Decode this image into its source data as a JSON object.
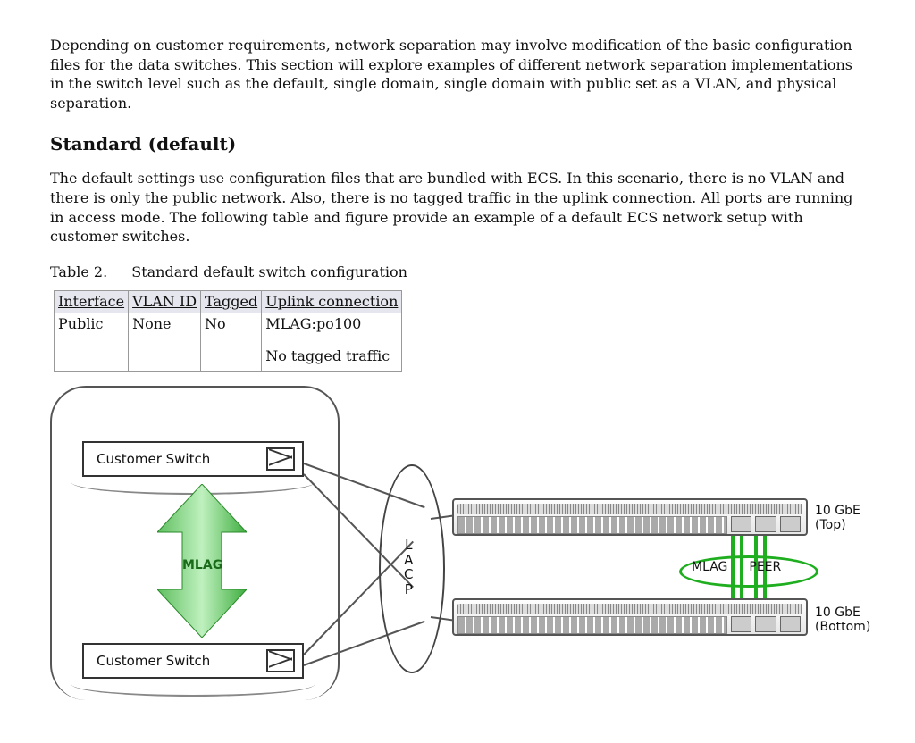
{
  "intro": "Depending on customer requirements, network separation may involve modification of the basic configuration files for the data switches. This section will explore examples of different network separation implementations in the switch level such as the default, single domain, single domain with public set as a VLAN, and physical separation.",
  "section_heading": "Standard (default)",
  "section_body": "The default settings use configuration files that are bundled with ECS. In this scenario, there is no VLAN and there is only the public network. Also, there is no tagged traffic in the uplink connection. All ports are running in access mode. The following table and figure provide an example of a default ECS network setup with customer switches.",
  "table_caption": {
    "num": "Table 2.",
    "title": "Standard default switch configuration"
  },
  "table": {
    "headers": [
      "Interface",
      "VLAN ID",
      "Tagged",
      "Uplink connection"
    ],
    "row": {
      "interface": "Public",
      "vlan_id": "None",
      "tagged": "No",
      "uplink_line1": "MLAG:po100",
      "uplink_line2": "No tagged traffic"
    }
  },
  "diagram": {
    "customer_switch": "Customer Switch",
    "mlag": "MLAG",
    "lacp": "LACP",
    "mlag_peer": "MLAG    PEER",
    "mlag_peer_left": "MLAG",
    "mlag_peer_right": "PEER",
    "gbe_top": "10 GbE\n(Top)",
    "gbe_top_l1": "10 GbE",
    "gbe_top_l2": "(Top)",
    "gbe_bottom_l1": "10 GbE",
    "gbe_bottom_l2": "(Bottom)"
  }
}
